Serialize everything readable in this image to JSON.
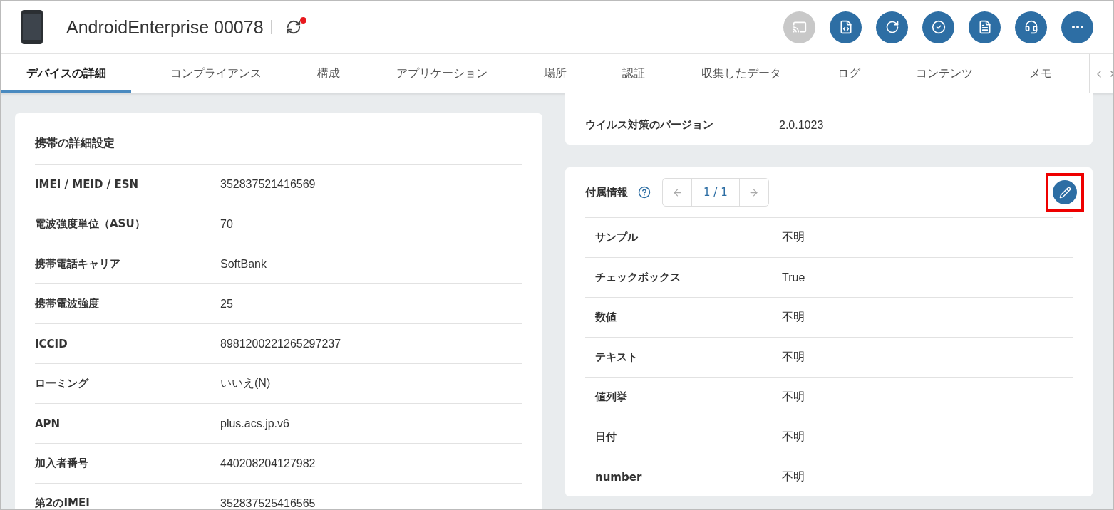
{
  "device": {
    "name": "AndroidEnterprise 00078",
    "sync_pending": true
  },
  "actions": [
    {
      "kind": "cast",
      "disabled": true
    },
    {
      "kind": "script",
      "disabled": false
    },
    {
      "kind": "restart",
      "disabled": false
    },
    {
      "kind": "check",
      "disabled": false
    },
    {
      "kind": "document",
      "disabled": false
    },
    {
      "kind": "support",
      "disabled": false
    },
    {
      "kind": "more",
      "disabled": false
    }
  ],
  "tabs": [
    {
      "label": "デバイスの詳細",
      "selected": true
    },
    {
      "label": "コンプライアンス",
      "selected": false
    },
    {
      "label": "構成",
      "selected": false
    },
    {
      "label": "アプリケーション",
      "selected": false
    },
    {
      "label": "場所",
      "selected": false
    },
    {
      "label": "認証",
      "selected": false
    },
    {
      "label": "収集したデータ",
      "selected": false
    },
    {
      "label": "ログ",
      "selected": false
    },
    {
      "label": "コンテンツ",
      "selected": false
    },
    {
      "label": "メモ",
      "selected": false
    }
  ],
  "mobile_card": {
    "title": "携帯の詳細設定",
    "rows": [
      {
        "label": "IMEI / MEID / ESN",
        "value": "352837521416569"
      },
      {
        "label": "電波強度単位（ASU）",
        "value": "70"
      },
      {
        "label": "携帯電話キャリア",
        "value": "SoftBank"
      },
      {
        "label": "携帯電波強度",
        "value": "25"
      },
      {
        "label": "ICCID",
        "value": "8981200221265297237"
      },
      {
        "label": "ローミング",
        "value": "いいえ(N)"
      },
      {
        "label": "APN",
        "value": "plus.acs.jp.v6"
      },
      {
        "label": "加入者番号",
        "value": "440208204127982"
      },
      {
        "label": "第2のIMEI",
        "value": "352837525416565"
      }
    ]
  },
  "security_card": {
    "rows": [
      {
        "label": "ウイルス対策のバージョン",
        "value": "2.0.1023"
      }
    ]
  },
  "custom_card": {
    "title": "付属情報",
    "pager": "1 / 1",
    "edit_highlighted": true,
    "rows": [
      {
        "label": "サンプル",
        "value": "不明"
      },
      {
        "label": "チェックボックス",
        "value": "True"
      },
      {
        "label": "数値",
        "value": "不明"
      },
      {
        "label": "テキスト",
        "value": "不明"
      },
      {
        "label": "値列挙",
        "value": "不明"
      },
      {
        "label": "日付",
        "value": "不明"
      },
      {
        "label": "number",
        "value": "不明"
      }
    ]
  }
}
